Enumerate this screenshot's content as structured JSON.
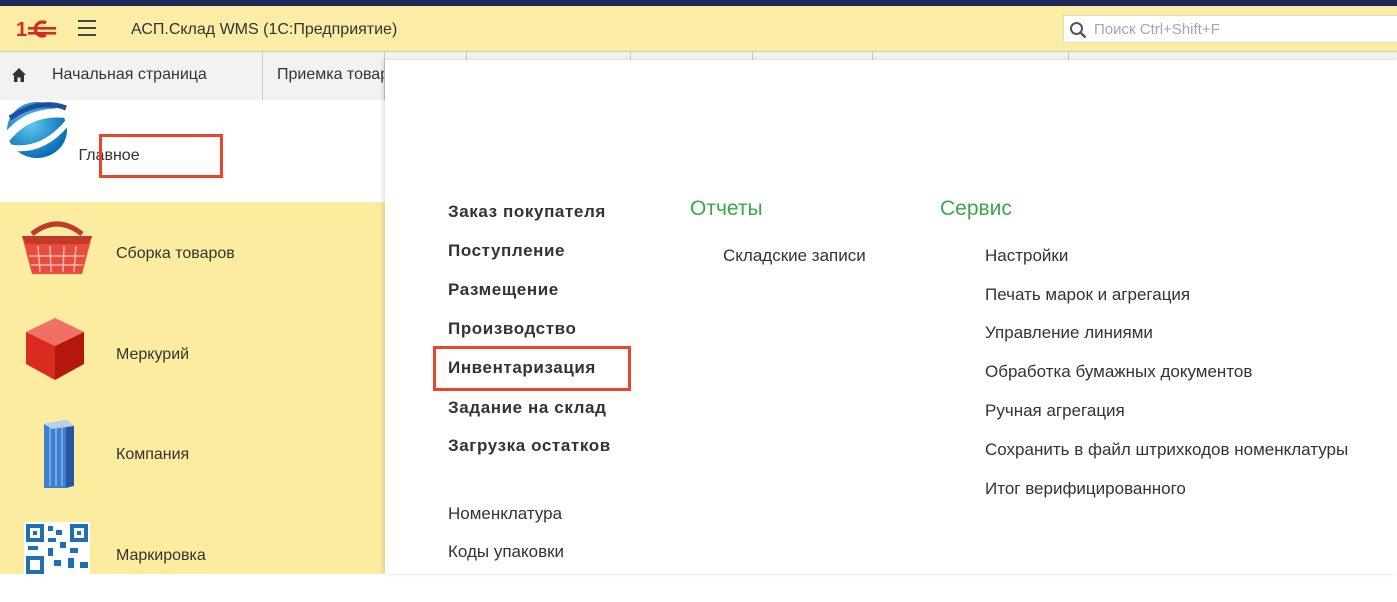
{
  "app": {
    "title": "АСП.Склад WMS  (1С:Предприятие)",
    "search_placeholder": "Поиск Ctrl+Shift+F"
  },
  "tabs": [
    {
      "label": "Начальная страница",
      "icon": "home-icon"
    },
    {
      "label": "Приемка товаров"
    }
  ],
  "sidebar": {
    "items": [
      {
        "label": "Главное",
        "icon": "main-globe-icon"
      },
      {
        "label": "Сборка товаров",
        "icon": "basket-icon"
      },
      {
        "label": "Меркурий",
        "icon": "red-cube-icon"
      },
      {
        "label": "Компания",
        "icon": "building-icon"
      },
      {
        "label": "Маркировка",
        "icon": "qr-code-icon"
      }
    ]
  },
  "menu": {
    "main_bold": [
      "Заказ покупателя",
      "Поступление",
      "Размещение",
      "Производство",
      "Инвентаризация",
      "Задание на склад",
      "Загрузка остатков"
    ],
    "main_plain": [
      "Номенклатура",
      "Коды упаковки"
    ],
    "reports": {
      "title": "Отчеты",
      "items": [
        "Складские записи"
      ]
    },
    "service": {
      "title": "Сервис",
      "items": [
        "Настройки",
        "Печать марок и агрегация",
        "Управление линиями",
        "Обработка бумажных документов",
        "Ручная агрегация",
        "Сохранить в файл штрихкодов номенклатуры",
        "Итог верифицированного"
      ]
    }
  },
  "colors": {
    "title_bar": "#fbeda5",
    "sidebar": "#fcec9f",
    "section_title": "#3ca64a",
    "highlight": "#e8462a"
  }
}
